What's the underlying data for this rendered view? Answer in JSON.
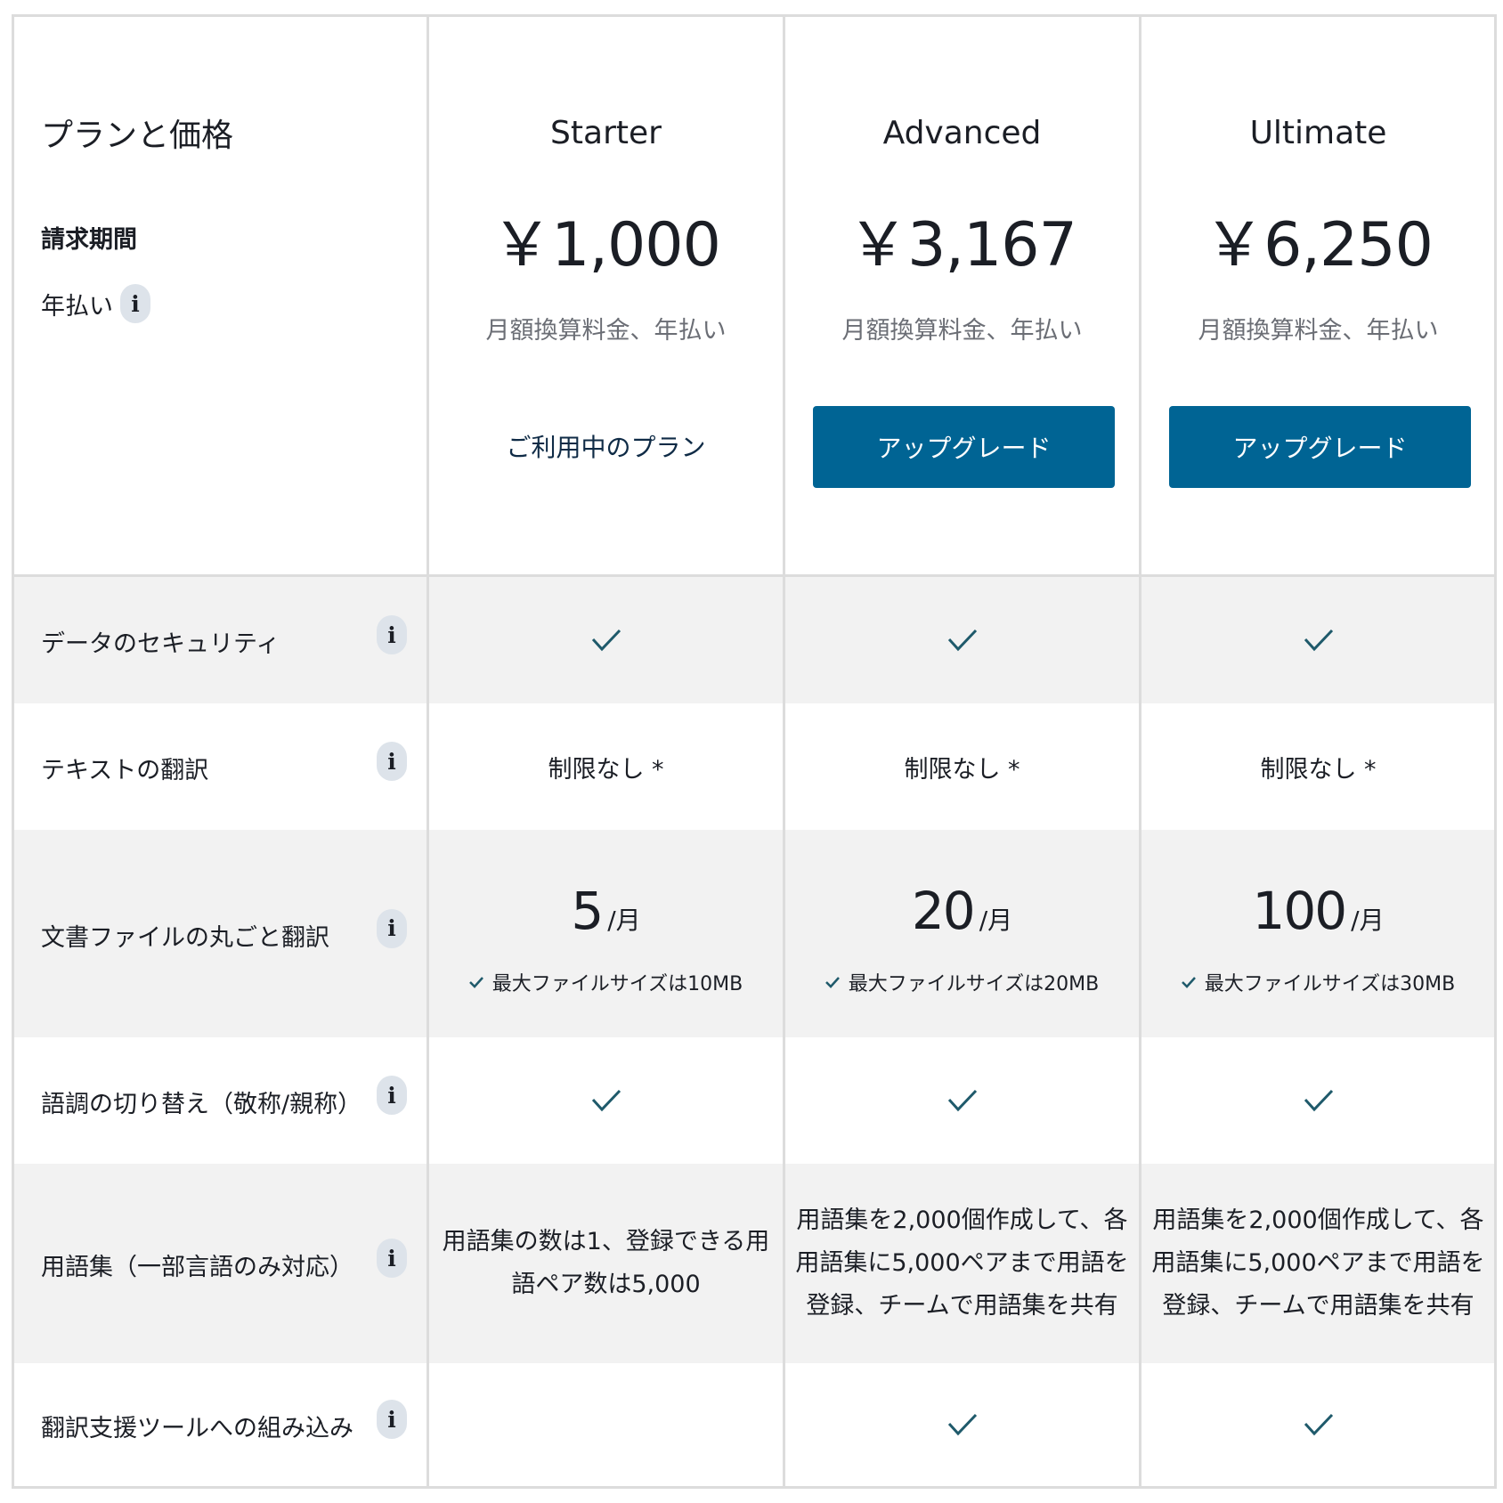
{
  "header": {
    "title": "プランと価格",
    "billing_label": "請求期間",
    "billing_value": "年払い",
    "info_glyph": "i"
  },
  "plans": [
    {
      "name": "Starter",
      "price": "￥1,000",
      "note": "月額換算料金、年払い",
      "action": "ご利用中のプラン",
      "action_type": "current"
    },
    {
      "name": "Advanced",
      "price": "￥3,167",
      "note": "月額換算料金、年払い",
      "action": "アップグレード",
      "action_type": "button"
    },
    {
      "name": "Ultimate",
      "price": "￥6,250",
      "note": "月額換算料金、年払い",
      "action": "アップグレード",
      "action_type": "button"
    }
  ],
  "features": [
    {
      "label": "データのセキュリティ",
      "values": [
        "check",
        "check",
        "check"
      ]
    },
    {
      "label": "テキストの翻訳",
      "values": [
        "制限なし *",
        "制限なし *",
        "制限なし *"
      ]
    },
    {
      "label": "文書ファイルの丸ごと翻訳",
      "quota": [
        "5",
        "20",
        "100"
      ],
      "quota_unit": "/月",
      "sub_notes": [
        "最大ファイルサイズは10MB",
        "最大ファイルサイズは20MB",
        "最大ファイルサイズは30MB"
      ]
    },
    {
      "label": "語調の切り替え（敬称/親称）",
      "values": [
        "check",
        "check",
        "check"
      ]
    },
    {
      "label": "用語集（一部言語のみ対応）",
      "values": [
        "用語集の数は1、登録できる用\n語ペア数は5,000",
        "用語集を2,000個作成して、各\n用語集に5,000ペアまで用語を\n登録、チームで用語集を共有",
        "用語集を2,000個作成して、各\n用語集に5,000ペアまで用語を\n登録、チームで用語集を共有"
      ]
    },
    {
      "label": "翻訳支援ツールへの組み込み",
      "values": [
        "",
        "check",
        "check"
      ]
    }
  ],
  "colors": {
    "accent": "#006494",
    "check": "#1f5a6b",
    "band": "#f2f2f2",
    "border": "#dcdcdc"
  },
  "icons": {
    "check": "check-icon",
    "info": "info-icon"
  }
}
